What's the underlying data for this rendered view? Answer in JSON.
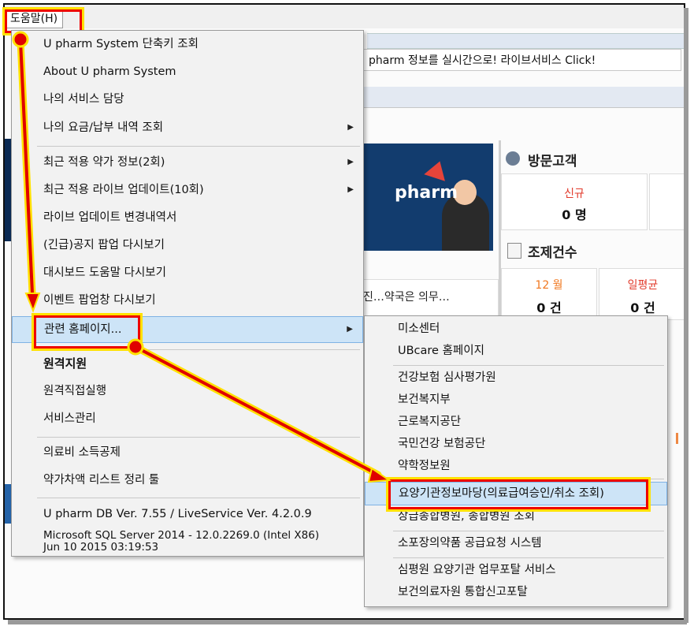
{
  "menubar": {
    "help_label": "도움말(H)"
  },
  "background": {
    "ticker_text": "pharm 정보를 실시간으로! 라이브서비스 Click!",
    "banner_logo": "pharm",
    "news_text": "진…약국은 의무…",
    "visitors": {
      "title": "방문고객",
      "new_label": "신규",
      "new_value": "0 명"
    },
    "prescriptions": {
      "title": "조제건수",
      "month_label": "12 월",
      "month_value": "0 건",
      "daily_label": "일평균",
      "daily_value": "0 건"
    }
  },
  "help_menu": {
    "items": [
      {
        "label": "U pharm System 단축키 조회"
      },
      {
        "label": "About U pharm System"
      },
      {
        "label": "나의 서비스 담당"
      },
      {
        "label": "나의 요금/납부 내역 조회",
        "submenu": true
      },
      {
        "label": "최근 적용 약가 정보(2회)",
        "submenu": true
      },
      {
        "label": "최근 적용 라이브 업데이트(10회)",
        "submenu": true
      },
      {
        "label": "라이브 업데이트 변경내역서"
      },
      {
        "label": "(긴급)공지 팝업 다시보기"
      },
      {
        "label": "대시보드 도움말 다시보기"
      },
      {
        "label": "이벤트 팝업창 다시보기"
      },
      {
        "label": "관련 홈페이지...",
        "submenu": true,
        "highlighted": true
      },
      {
        "label": "원격지원",
        "bold": true
      },
      {
        "label": "원격직접실행"
      },
      {
        "label": "서비스관리"
      },
      {
        "label": "의료비 소득공제"
      },
      {
        "label": "약가차액 리스트 정리 툴"
      }
    ],
    "version_line": "U pharm DB Ver. 7.55 / LiveService Ver. 4.2.0.9",
    "sql_line1": "Microsoft SQL Server 2014 - 12.0.2269.0 (Intel X86)",
    "sql_line2": "Jun 10 2015 03:19:53"
  },
  "related_sites_submenu": {
    "items": [
      {
        "label": "미소센터"
      },
      {
        "label": "UBcare 홈페이지"
      },
      {
        "label": "건강보험 심사평가원"
      },
      {
        "label": "보건복지부"
      },
      {
        "label": "근로복지공단"
      },
      {
        "label": "국민건강 보험공단"
      },
      {
        "label": "약학정보원"
      },
      {
        "label": "요양기관정보마당(의료급여승인/취소 조회)",
        "highlighted": true
      },
      {
        "label": "상급종합병원, 종합병원 조회"
      },
      {
        "label": "소포장의약품 공급요청 시스템"
      },
      {
        "label": "심평원 요양기관 업무포탈 서비스"
      },
      {
        "label": "보건의료자원 통합신고포탈"
      }
    ]
  },
  "colors": {
    "highlight_border": "#e00000",
    "highlight_glow": "#ffe100",
    "menu_hover": "#cde4f7",
    "arrow": "#e00000"
  }
}
